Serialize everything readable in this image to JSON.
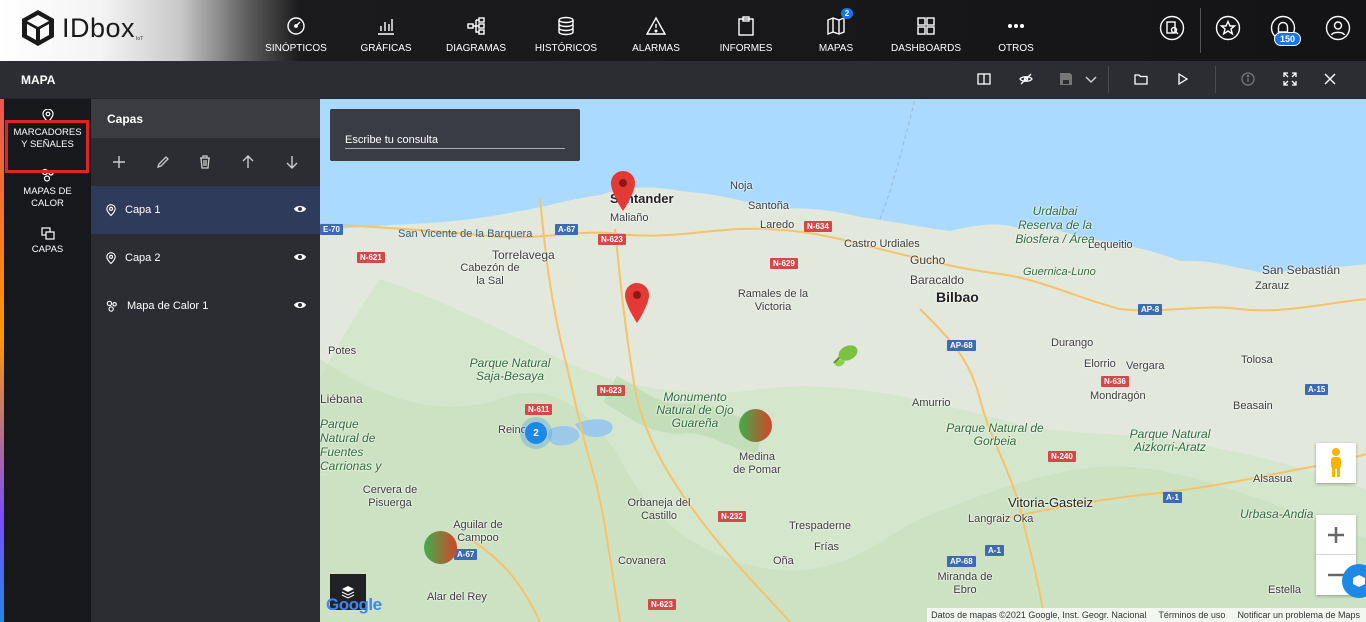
{
  "app": {
    "logo_text": "IDbox",
    "logo_sup": "IoT"
  },
  "nav": [
    {
      "label": "SINÓPTICOS",
      "icon": "gauge-icon"
    },
    {
      "label": "GRÁFICAS",
      "icon": "bar-chart-icon"
    },
    {
      "label": "DIAGRAMAS",
      "icon": "diagram-icon"
    },
    {
      "label": "HISTÓRICOS",
      "icon": "database-icon"
    },
    {
      "label": "ALARMAS",
      "icon": "warning-icon"
    },
    {
      "label": "INFORMES",
      "icon": "clipboard-icon"
    },
    {
      "label": "MAPAS",
      "icon": "map-icon",
      "badge": "2"
    },
    {
      "label": "DASHBOARDS",
      "icon": "dashboard-icon"
    },
    {
      "label": "OTROS",
      "icon": "more-icon"
    }
  ],
  "top_right": {
    "notifications_badge": "150"
  },
  "subbar": {
    "title": "MAPA"
  },
  "leftnav": [
    {
      "label": "MARCADORES Y SEÑALES",
      "line1": "MARCADORES",
      "line2": "Y SEÑALES"
    },
    {
      "label": "MAPAS DE CALOR",
      "line1": "MAPAS DE",
      "line2": "CALOR"
    },
    {
      "label": "CAPAS",
      "line1": "CAPAS",
      "line2": ""
    }
  ],
  "panel": {
    "title": "Capas",
    "layers": [
      {
        "name": "Capa 1",
        "selected": true
      },
      {
        "name": "Capa 2",
        "selected": false
      },
      {
        "name": "Mapa de Calor 1",
        "selected": false
      }
    ]
  },
  "map": {
    "search_placeholder": "Escribe tu consulta",
    "cluster_count": "2",
    "google_logo": "Google",
    "footer": {
      "attribution": "Datos de mapas ©2021 Google, Inst. Geogr. Nacional",
      "terms": "Términos de uso",
      "report": "Notificar un problema de Maps"
    },
    "places": [
      "Santander",
      "Maliaño",
      "Noja",
      "Santoña",
      "Laredo",
      "Castro Urdiales",
      "San Vicente de la Barquera",
      "Torrelavega",
      "Cabezón de la Sal",
      "Ramales de la Victoria",
      "Gucho",
      "Baracaldo",
      "Bilbao",
      "Lequeitio",
      "San Sebastián",
      "Zarauz",
      "Potes",
      "Liébana",
      "Reinosa",
      "Medina de Pomar",
      "Durango",
      "Elorrio",
      "Vergara",
      "Mondragón",
      "Tolosa",
      "Amurrio",
      "Beasain",
      "Alsasua",
      "Vitoria-Gasteiz",
      "Langraiz Oka",
      "Orbaneja del Castillo",
      "Trespaderne",
      "Frías",
      "Covanera",
      "Oña",
      "Miranda de Ebro",
      "Aguilar de Campoo",
      "Cervera de Pisuerga",
      "Alar del Rey",
      "Estella",
      "Guernica-Luno"
    ],
    "parks": [
      "Parque Natural Saja-Besaya",
      "Monumento Natural de Ojo Guareña",
      "Urdaibai Reserva de la Biosfera / Área de...",
      "Parque Natural de Gorbeia",
      "Parque Natural Aizkorri-Aratz",
      "Urbasa-Andia",
      "Parque Natural de Fuentes Carrionas y Fuente..."
    ],
    "roads": [
      "E-70",
      "N-621",
      "A-67",
      "N-623",
      "N-634",
      "N-629",
      "AP-8",
      "AP-68",
      "N-636",
      "A-15",
      "N-611",
      "N-240",
      "A-1",
      "N-232",
      "A-67",
      "N-623",
      "AP-68"
    ]
  }
}
